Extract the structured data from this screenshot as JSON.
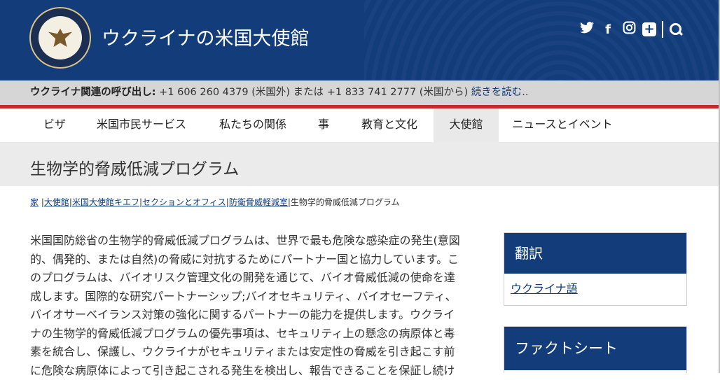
{
  "header": {
    "site_title": "ウクライナの米国大使館",
    "seal_icon": "department-of-state-seal",
    "bg_color": "#123c7a",
    "social": [
      {
        "name": "twitter",
        "glyph": "🐦"
      },
      {
        "name": "facebook",
        "glyph": "f"
      },
      {
        "name": "instagram",
        "glyph": "◎"
      },
      {
        "name": "plus",
        "glyph": "+"
      }
    ]
  },
  "alert": {
    "label": "ウクライナ関連の呼び出し:",
    "text": " +1 606 260 4379 (米国外) または +1 833 741 2777 (米国から) ",
    "link": "続きを読む",
    "suffix": ".."
  },
  "nav": [
    "ビザ",
    "米国市民サービス",
    "私たちの関係",
    "事",
    "教育と文化",
    "大使館",
    "ニュースとイベント"
  ],
  "page_title": "生物学的脅威低減プログラム",
  "breadcrumb": {
    "links": [
      "家",
      "大使館",
      "米国大使館キエフ",
      "セクションとオフィス",
      "防衛脅威軽減室"
    ],
    "current": "生物学的脅威低減プログラム"
  },
  "body": "米国国防総省の生物学的脅威低減プログラムは、世界で最も危険な感染症の発生(意図的、偶発的、または自然)の脅威に対抗するためにパートナー国と協力しています。このプログラムは、バイオリスク管理文化の開発を通じて、バイオ脅威低減の使命を達成します。国際的な研究パートナーシップ;バイオセキュリティ、バイオセーフティ、バイオサーベイランス対策の強化に関するパートナーの能力を提供します。ウクライナの生物学的脅威低減プログラムの優先事項は、セキュリティ上の懸念の病原体と毒素を統合し、保護し、ウクライナがセキュリティまたは安定性の脅威を引き起こす前に危険な病原体によって引き起こされる発生を検出し、報告できることを保証し続け",
  "sidebar": {
    "translate": {
      "title": "翻訳",
      "link": "ウクライナ語"
    },
    "factsheet": {
      "title": "ファクトシート"
    }
  }
}
